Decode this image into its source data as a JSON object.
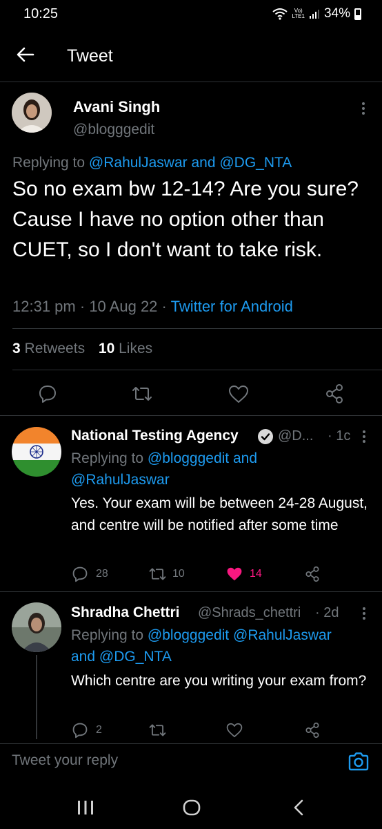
{
  "status_bar": {
    "time": "10:25",
    "battery": "34%",
    "network_top": "Vo)",
    "network_bottom": "LTE1"
  },
  "header": {
    "title": "Tweet"
  },
  "main_tweet": {
    "name": "Avani Singh",
    "handle": "@blogggedit",
    "replying_prefix": "Replying to",
    "replying_user1": "@RahulJaswar",
    "replying_and": "and",
    "replying_user2": "@DG_NTA",
    "text": "So no exam bw 12-14? Are you sure? Cause I have no option other than CUET, so I don't want to take risk.",
    "time": "12:31 pm",
    "date": "10 Aug 22",
    "client": "Twitter for Android",
    "retweets_count": "3",
    "retweets_label": "Retweets",
    "likes_count": "10",
    "likes_label": "Likes"
  },
  "replies": [
    {
      "name": "National Testing Agency",
      "handle": "@D...",
      "age": "· 1c",
      "replying_prefix": "Replying to",
      "replying_user1": "@blogggedit",
      "replying_and": "and",
      "replying_user2": "@RahulJaswar",
      "text": "Yes. Your exam will be between 24-28 August,  and centre will be notified after some time",
      "replies": "28",
      "retweets": "10",
      "likes": "14",
      "liked": true
    },
    {
      "name": "Shradha Chettri",
      "handle": "@Shrads_chettri",
      "age": "· 2d",
      "replying_prefix": "Replying to",
      "replying_user1": "@blogggedit",
      "replying_user2": "@RahulJaswar",
      "replying_and": "and",
      "replying_user3": "@DG_NTA",
      "text": "Which centre are you writing your exam from?",
      "replies": "2"
    }
  ],
  "composer": {
    "placeholder": "Tweet your reply"
  },
  "colors": {
    "accent": "#1d9bf0",
    "like": "#f91880",
    "muted": "#71767b",
    "background": "#000000"
  }
}
